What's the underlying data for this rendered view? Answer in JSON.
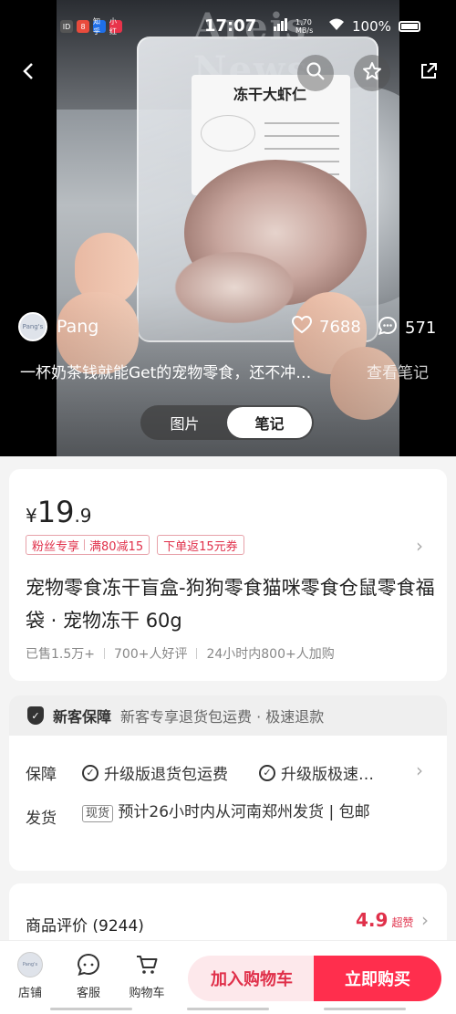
{
  "status_bar": {
    "time": "17:07",
    "network": "1.70 MB/s",
    "battery": "100%",
    "mini_apps": [
      {
        "name": "app-icon-1",
        "label": "ID",
        "color": "#555"
      },
      {
        "name": "app-icon-2",
        "label": "8",
        "color": "#e84b3c"
      },
      {
        "name": "app-icon-3",
        "label": "知乎",
        "color": "#1f6fe8"
      },
      {
        "name": "app-icon-4",
        "label": "小红",
        "color": "#e8334a"
      }
    ]
  },
  "hero": {
    "newspaper_text": "Areis News",
    "package_label_title": "冻干大虾仁",
    "author_name": "Pang",
    "avatar_text": "Pang's",
    "likes": "7688",
    "comments": "571",
    "caption": "一杯奶茶钱就能Get的宠物零食，还不冲…",
    "caption_more": "查看笔记",
    "tabs": [
      {
        "label": "图片",
        "active": false
      },
      {
        "label": "笔记",
        "active": true
      }
    ]
  },
  "product": {
    "currency": "¥",
    "price_int": "19",
    "price_dec": ".9",
    "tag1_a": "粉丝专享",
    "tag1_b": "满80减15",
    "tag2": "下单返15元券",
    "title": "宠物零食冻干盲盒-狗狗零食猫咪零食仓鼠零食福袋 · 宠物冻干 60g",
    "sold": "已售1.5万+",
    "reviews_good": "700+人好评",
    "cart_adds": "24小时内800+人加购"
  },
  "guarantee": {
    "title": "新客保障",
    "desc": "新客专享退货包运费 · 极速退款",
    "shield_glyph": "✓"
  },
  "service": {
    "guarantee_label": "保障",
    "guarantee_item1": "升级版退货包运费",
    "guarantee_item2": "升级版极速…",
    "shipping_label": "发货",
    "shipping_badge": "现货",
    "shipping_text": "预计26小时内从河南郑州发货 | 包邮"
  },
  "reviews": {
    "title": "商品评价 (9244)",
    "rating": "4.9",
    "rating_text": "超赞"
  },
  "bottom_bar": {
    "shop_label": "店铺",
    "service_label": "客服",
    "cart_label": "购物车",
    "add_cart_label": "加入购物车",
    "buy_now_label": "立即购买"
  },
  "colors": {
    "accent": "#ff2e4d",
    "accent_text": "#e0304a",
    "accent_light": "#fde8eb"
  },
  "icons": [
    "back-icon",
    "search-icon",
    "star-icon",
    "share-icon",
    "heart-icon",
    "comment-icon",
    "chevron-right-icon",
    "shield-icon",
    "check-circle-icon",
    "service-icon",
    "cart-icon"
  ]
}
